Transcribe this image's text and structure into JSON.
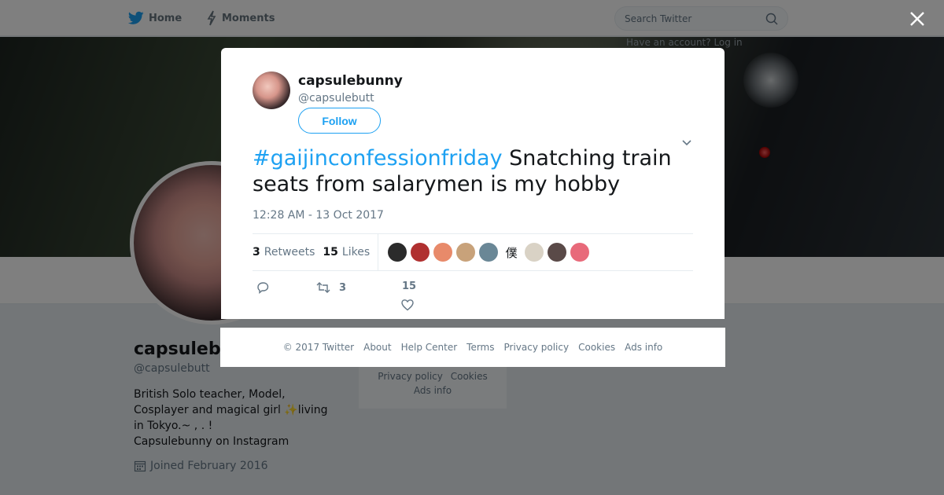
{
  "nav": {
    "home_label": "Home",
    "moments_label": "Moments",
    "search_placeholder": "Search Twitter"
  },
  "banner": {
    "overlay_text": "Have an account? Log in"
  },
  "profile": {
    "name": "capsulebunny",
    "handle": "@capsulebutt",
    "bio": "British Solo teacher, Model,\nCosplayer and magical girl ✨living\nin Tokyo.~ , . !\nCapsulebunny on Instagram",
    "joined": "Joined February 2016"
  },
  "side_footer": {
    "links": [
      "Privacy policy",
      "Cookies",
      "Ads info"
    ]
  },
  "tweet": {
    "author_name": "capsulebunny",
    "author_handle": "@capsulebutt",
    "follow_label": "Follow",
    "hashtag": "#gaijinconfessionfriday",
    "text": " Snatching train seats from salarymen is my hobby",
    "timestamp": "12:28 AM - 13 Oct 2017",
    "retweets_count": "3",
    "retweets_label": "Retweets",
    "likes_count": "15",
    "likes_label": "Likes",
    "action_retweet_count": "3",
    "action_like_count": "15",
    "likers": [
      {
        "color": "#2b2b2b",
        "glyph": ""
      },
      {
        "color": "#b03030",
        "glyph": ""
      },
      {
        "color": "#e88a6a",
        "glyph": ""
      },
      {
        "color": "#c8a27a",
        "glyph": ""
      },
      {
        "color": "#6a8796",
        "glyph": ""
      },
      {
        "color": "#ffffff",
        "glyph": "僕"
      },
      {
        "color": "#d9d2c5",
        "glyph": ""
      },
      {
        "color": "#5a4a48",
        "glyph": ""
      },
      {
        "color": "#e86a7a",
        "glyph": ""
      }
    ]
  },
  "modal_footer": {
    "links": [
      "© 2017 Twitter",
      "About",
      "Help Center",
      "Terms",
      "Privacy policy",
      "Cookies",
      "Ads info"
    ]
  },
  "colors": {
    "accent": "#1da1f2",
    "muted": "#657786"
  }
}
